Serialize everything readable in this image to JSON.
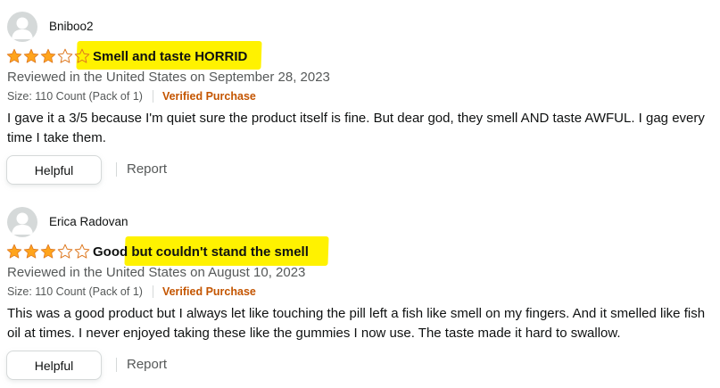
{
  "colors": {
    "star_fill": "#ffa41c",
    "star_outline": "#de7921",
    "highlight": "#fff200",
    "verified": "#c45500",
    "secondary_text": "#565959"
  },
  "reviews": [
    {
      "author": "Bniboo2",
      "avatar_icon": "default-user-avatar-icon",
      "rating": 3,
      "rating_max": 5,
      "title": "Smell and taste HORRID",
      "date_line": "Reviewed in the United States on September 28, 2023",
      "variant": "Size: 110 Count (Pack of 1)",
      "badge": "Verified Purchase",
      "body": "I gave it a 3/5 because I'm quiet sure the product itself is fine. But dear god, they smell AND taste AWFUL. I gag every time I take them.",
      "helpful_label": "Helpful",
      "report_label": "Report"
    },
    {
      "author": "Erica Radovan",
      "avatar_icon": "default-user-avatar-icon",
      "rating": 3,
      "rating_max": 5,
      "title": "Good but couldn't stand the smell",
      "date_line": "Reviewed in the United States on August 10, 2023",
      "variant": "Size: 110 Count (Pack of 1)",
      "badge": "Verified Purchase",
      "body": "This was a good product but I always let like touching the pill left a fish like smell on my fingers. And it smelled like fish oil at times. I never enjoyed taking these like the gummies I now use. The taste made it hard to swallow.",
      "helpful_label": "Helpful",
      "report_label": "Report"
    }
  ]
}
